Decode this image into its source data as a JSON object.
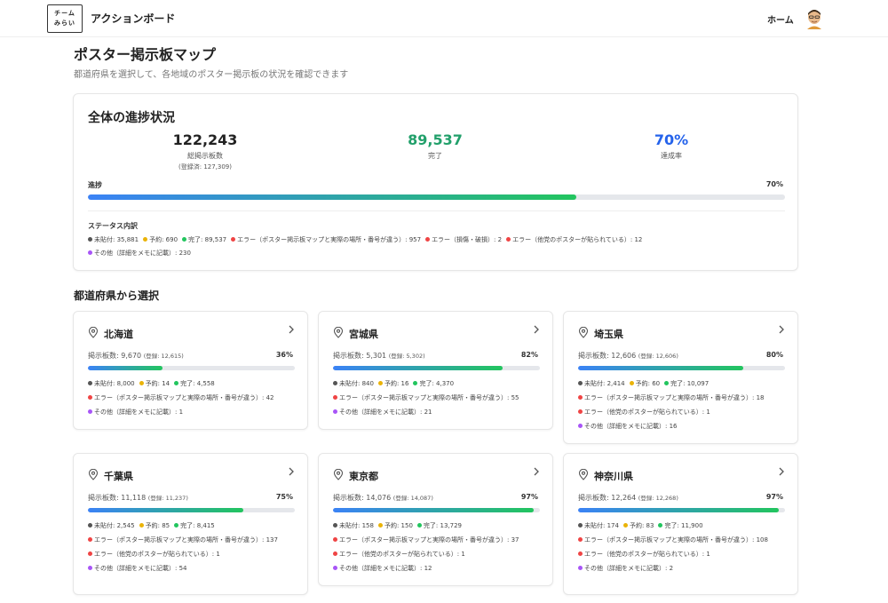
{
  "header": {
    "logo_line1": "チーム",
    "logo_line2": "みらい",
    "app_title": "アクションボード",
    "home_label": "ホーム"
  },
  "page": {
    "title": "ポスター掲示板マップ",
    "subtitle": "都道府県を選択して、各地域のポスター掲示板の状況を確認できます"
  },
  "overall": {
    "title": "全体の進捗状況",
    "total_value": "122,243",
    "total_label": "総掲示板数",
    "registered_label": "(登録済: 127,309)",
    "completed_value": "89,537",
    "completed_label": "完了",
    "rate_value": "70%",
    "rate_label": "達成率",
    "progress_label": "進捗",
    "progress_pct": "70%",
    "progress_fraction": 0.7,
    "status_heading": "ステータス内訳",
    "status_line1": [
      {
        "color": "#555555",
        "text": "未貼付: 35,881"
      },
      {
        "color": "#eab308",
        "text": "予約: 690"
      },
      {
        "color": "#22c55e",
        "text": "完了: 89,537"
      },
      {
        "color": "#ef4444",
        "text": "エラー（ポスター掲示板マップと実際の場所・番号が違う）: 957"
      },
      {
        "color": "#ef4444",
        "text": "エラー（損傷・破損）: 2"
      },
      {
        "color": "#ef4444",
        "text": "エラー（他党のポスターが貼られている）: 12"
      }
    ],
    "status_line2": [
      {
        "color": "#a855f7",
        "text": "その他（詳細をメモに記載）: 230"
      }
    ]
  },
  "section_title": "都道府県から選択",
  "prefectures": [
    {
      "name": "北海道",
      "count": "掲示板数: 9,670",
      "registered": "(登録: 12,615)",
      "pct": "36%",
      "fraction": 0.36,
      "line1": [
        {
          "color": "#555555",
          "text": "未貼付: 8,000"
        },
        {
          "color": "#eab308",
          "text": "予約: 14"
        },
        {
          "color": "#22c55e",
          "text": "完了: 4,558"
        }
      ],
      "lines": [
        {
          "color": "#ef4444",
          "text": "エラー（ポスター掲示板マップと実際の場所・番号が違う）: 42"
        },
        {
          "color": "#a855f7",
          "text": "その他（詳細をメモに記載）: 1"
        }
      ]
    },
    {
      "name": "宮城県",
      "count": "掲示板数: 5,301",
      "registered": "(登録: 5,302)",
      "pct": "82%",
      "fraction": 0.82,
      "line1": [
        {
          "color": "#555555",
          "text": "未貼付: 840"
        },
        {
          "color": "#eab308",
          "text": "予約: 16"
        },
        {
          "color": "#22c55e",
          "text": "完了: 4,370"
        }
      ],
      "lines": [
        {
          "color": "#ef4444",
          "text": "エラー（ポスター掲示板マップと実際の場所・番号が違う）: 55"
        },
        {
          "color": "#a855f7",
          "text": "その他（詳細をメモに記載）: 21"
        }
      ]
    },
    {
      "name": "埼玉県",
      "count": "掲示板数: 12,606",
      "registered": "(登録: 12,606)",
      "pct": "80%",
      "fraction": 0.8,
      "line1": [
        {
          "color": "#555555",
          "text": "未貼付: 2,414"
        },
        {
          "color": "#eab308",
          "text": "予約: 60"
        },
        {
          "color": "#22c55e",
          "text": "完了: 10,097"
        }
      ],
      "lines": [
        {
          "color": "#ef4444",
          "text": "エラー（ポスター掲示板マップと実際の場所・番号が違う）: 18"
        },
        {
          "color": "#ef4444",
          "text": "エラー（他党のポスターが貼られている）: 1"
        },
        {
          "color": "#a855f7",
          "text": "その他（詳細をメモに記載）: 16"
        }
      ]
    },
    {
      "name": "千葉県",
      "count": "掲示板数: 11,118",
      "registered": "(登録: 11,237)",
      "pct": "75%",
      "fraction": 0.75,
      "line1": [
        {
          "color": "#555555",
          "text": "未貼付: 2,545"
        },
        {
          "color": "#eab308",
          "text": "予約: 85"
        },
        {
          "color": "#22c55e",
          "text": "完了: 8,415"
        }
      ],
      "lines": [
        {
          "color": "#ef4444",
          "text": "エラー（ポスター掲示板マップと実際の場所・番号が違う）: 137"
        },
        {
          "color": "#ef4444",
          "text": "エラー（他党のポスターが貼られている）: 1"
        },
        {
          "color": "#a855f7",
          "text": "その他（詳細をメモに記載）: 54"
        }
      ]
    },
    {
      "name": "東京都",
      "count": "掲示板数: 14,076",
      "registered": "(登録: 14,087)",
      "pct": "97%",
      "fraction": 0.97,
      "line1": [
        {
          "color": "#555555",
          "text": "未貼付: 158"
        },
        {
          "color": "#eab308",
          "text": "予約: 150"
        },
        {
          "color": "#22c55e",
          "text": "完了: 13,729"
        }
      ],
      "lines": [
        {
          "color": "#ef4444",
          "text": "エラー（ポスター掲示板マップと実際の場所・番号が違う）: 37"
        },
        {
          "color": "#ef4444",
          "text": "エラー（他党のポスターが貼られている）: 1"
        },
        {
          "color": "#a855f7",
          "text": "その他（詳細をメモに記載）: 12"
        }
      ]
    },
    {
      "name": "神奈川県",
      "count": "掲示板数: 12,264",
      "registered": "(登録: 12,268)",
      "pct": "97%",
      "fraction": 0.97,
      "line1": [
        {
          "color": "#555555",
          "text": "未貼付: 174"
        },
        {
          "color": "#eab308",
          "text": "予約: 83"
        },
        {
          "color": "#22c55e",
          "text": "完了: 11,900"
        }
      ],
      "lines": [
        {
          "color": "#ef4444",
          "text": "エラー（ポスター掲示板マップと実際の場所・番号が違う）: 108"
        },
        {
          "color": "#ef4444",
          "text": "エラー（他党のポスターが貼られている）: 1"
        },
        {
          "color": "#a855f7",
          "text": "その他（詳細をメモに記載）: 2"
        }
      ]
    }
  ],
  "colors": {
    "accent_green": "#22a06b",
    "accent_blue": "#2563eb",
    "progress_start": "#3b82f6",
    "progress_end": "#22c55e"
  }
}
